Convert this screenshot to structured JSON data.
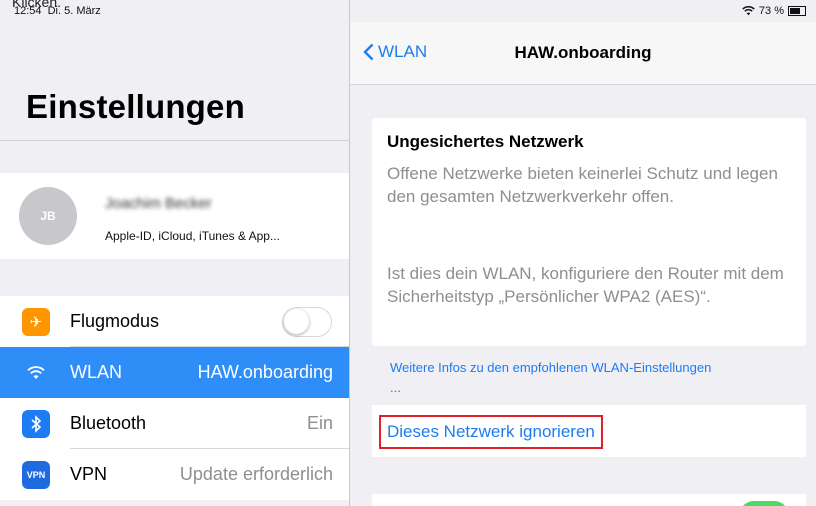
{
  "status": {
    "time": "12:54",
    "date": "Di. 5. März",
    "wifi_icon": "wifi-icon",
    "battery": "73 %",
    "battery_level": 0.73
  },
  "caption_clip": "Klicken.",
  "sidebar": {
    "title": "Einstellungen",
    "profile": {
      "avatar_initials": "JB",
      "name": "Joachim Becker",
      "subtitle": "Apple-ID, iCloud, iTunes & App..."
    },
    "items": [
      {
        "label": "Flugmodus",
        "value": "",
        "icon": "airplane-icon",
        "color": "#ff9500",
        "toggle": false
      },
      {
        "label": "WLAN",
        "value": "HAW.onboarding",
        "icon": "wifi-icon",
        "color": "#2f8df8",
        "selected": true
      },
      {
        "label": "Bluetooth",
        "value": "Ein",
        "icon": "bluetooth-icon",
        "color": "#1e7cf2"
      },
      {
        "label": "VPN",
        "value": "Update erforderlich",
        "icon": "vpn-icon",
        "color": "#1e6be0",
        "icon_text": "VPN"
      }
    ]
  },
  "detail": {
    "back_label": "WLAN",
    "title": "HAW.onboarding",
    "card": {
      "title": "Ungesichertes Netzwerk",
      "para1": "Offene Netzwerke bieten keinerlei Schutz und legen den gesamten Netzwerkverkehr offen.",
      "para2": "Ist dies dein WLAN, konfiguriere den Router mit dem Sicherheitstyp „Persönlicher WPA2 (AES)“."
    },
    "info_link": "Weitere Infos zu den empfohlenen WLAN-Einstellungen ...",
    "ignore_button": "Dieses Netzwerk ignorieren"
  },
  "colors": {
    "accent": "#1e7cf2",
    "selection": "#2f8df8",
    "highlight_border": "#e0202a",
    "toggle_on": "#4cd964"
  }
}
